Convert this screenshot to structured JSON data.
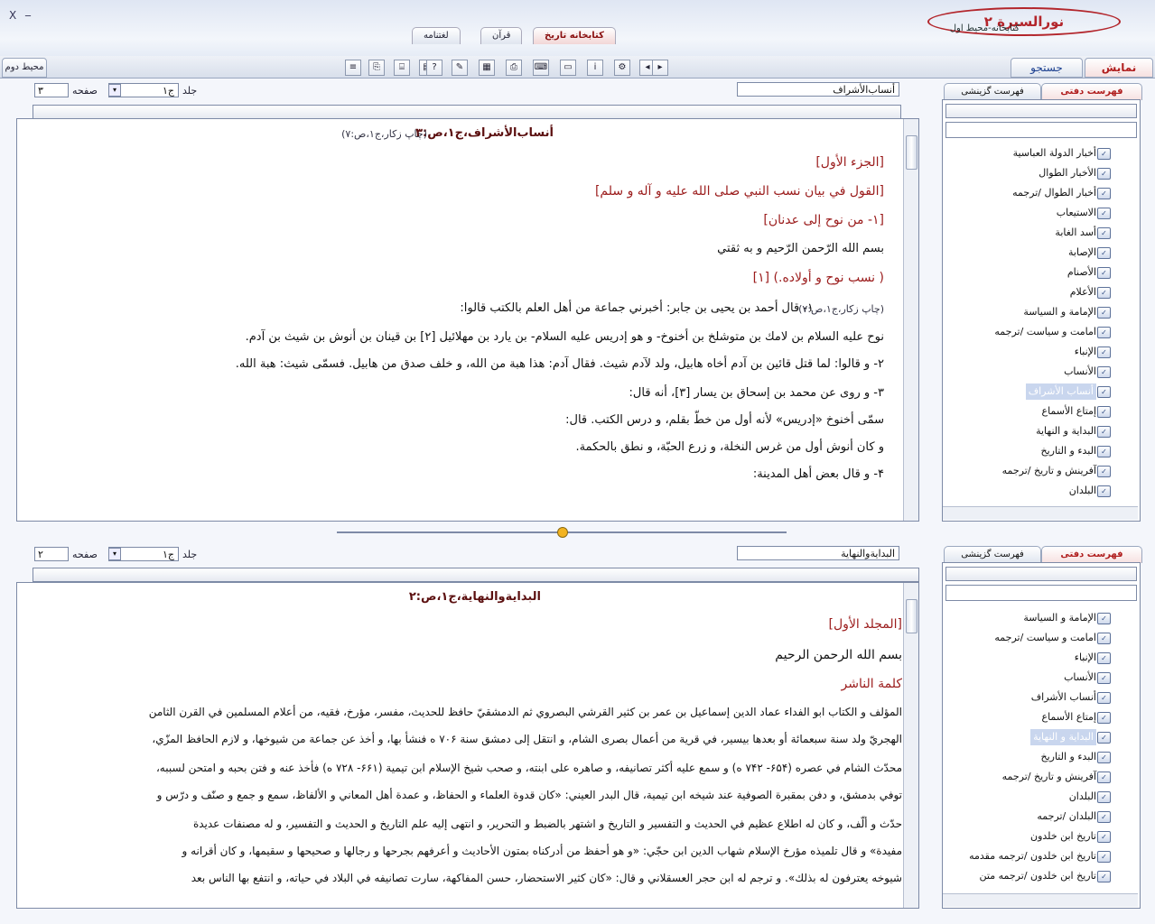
{
  "app": {
    "brand": "نورالسيرة ٢",
    "library_path": "كتابخانه-محيط اول",
    "minimize": "_",
    "close": "X"
  },
  "main_tabs": [
    "کتابخانه تاريخ",
    "قرآن",
    "لغتنامه"
  ],
  "second_bar": {
    "display": "نمايش",
    "search": "جستجو",
    "env2": "محيط دوم"
  },
  "pane1": {
    "book_select": "أنساب‌الأشراف",
    "jild_label": "جلد",
    "jild_value": "ج۱",
    "page_label": "صفحه",
    "page_value": "۳",
    "content_title": "أنساب‌الأشراف،ج۱،ص:۳",
    "content_title_note": "(چاپ زكار،ج۱،ص:۷)",
    "lines": [
      "[الجزء الأول]",
      "[القول في بيان نسب النبي صلى الله عليه و آله و سلم]",
      "[۱- من نوح إلى عدنان]",
      "بسم الله الرّحمن الرّحيم و به ثقتي",
      "( نسب نوح و أولاده.) [۱]",
      "۱- قال أحمد بن يحيى بن جابر: أخبرني جماعة من أهل العلم بالكتب قالوا:",
      "نوح عليه السلام بن لامك بن متوشلخ بن أخنوخ- و هو إدريس عليه السلام- بن يارد بن مهلائيل [۲] بن قينان بن أنوش بن شيث بن آدم.",
      "۲- و قالوا: لما قتل قائين بن آدم أخاه هابيل، ولد لآدم شيث. فقال آدم: هذا هبة من الله، و خلف صدق من هابيل. فسمّى شيث: هبة الله.",
      "۳- و روى عن محمد بن إسحاق بن يسار [۳]، أنه قال:",
      "سمّى أخنوخ «إدريس» لأنه أول من خطّ بقلم، و درس الكتب. قال:",
      "و كان أنوش أول من غرس النخلة، و زرع الحبّة، و نطق بالحكمة.",
      "۴- و قال بعض أهل المدينة:"
    ],
    "line2_prefix": "(چاپ زكار،ج۱،ص:۷)"
  },
  "pane2": {
    "book_select": "البداية‌والنهاية",
    "jild_label": "جلد",
    "jild_value": "ج۱",
    "page_label": "صفحه",
    "page_value": "۲",
    "content_title": "البداية‌والنهاية،ج۱،ص:۲",
    "lines": [
      "[المجلد الأول]",
      "بسم الله الرحمن الرحيم",
      "كلمة الناشر",
      "المؤلف و الكتاب ابو الفداء عماد الدين إسماعيل بن عمر بن كثير القرشي البصروي ثم الدمشقيّ حافظ للحديث، مفسر، مؤرخ، فقيه، من أعلام المسلمين في القرن الثامن",
      "الهجريّ ولد سنة سبعمائة أو بعدها بيسير، في قرية من أعمال بصرى الشام، و انتقل إلى دمشق سنة ۷۰۶ ه فنشأ بها، و أخذ عن جماعة من شيوخها، و لازم الحافظ المزّي،",
      "محدّث الشام في عصره (۶۵۴- ۷۴۲ ه) و سمع عليه أكثر تصانيفه، و صاهره على ابنته، و صحب شيخ الإسلام ابن تيمية (۶۶۱- ۷۲۸ ه) فأخذ عنه و فتن بحبه و امتحن لسببه،",
      "توفي بدمشق، و دفن بمقبرة الصوفية عند شيخه ابن تيمية، قال البدر العيني: «كان قدوة العلماء و الحفاظ، و عمدة أهل المعاني و الألفاظ، سمع و جمع و صنّف و درّس و",
      "حدّث و ألّف، و كان له اطلاع عظيم في الحديث و التفسير و التاريخ و اشتهر بالضبط و التحرير، و انتهى إليه علم التاريخ و الحديث و التفسير، و له مصنفات عديدة",
      "مفيدة» و قال تلميذه مؤرخ الإسلام شهاب الدين ابن حجّي: «و هو أحفظ من أدركناه بمتون الأحاديث و أعرفهم بجرحها و رجالها و صحيحها و سقيمها، و كان أقرانه و",
      "شيوخه يعترفون له بذلك». و ترجم له ابن حجر العسقلاني و قال: «كان كثير الاستحضار، حسن المفاكهة، سارت تصانيفه في البلاد في حياته، و انتفع بها الناس بعد"
    ]
  },
  "tree1": {
    "tab_index": "فهرست دفتى",
    "tab_search": "فهرست گزينشى",
    "items": [
      "أخبار الدولة العباسية",
      "الأخبار الطوال",
      "أخبار الطوال /ترجمه",
      "الاستيعاب",
      "أسد الغابة",
      "الإصابة",
      "الأصنام",
      "الأعلام",
      "الإمامة و السياسة",
      "امامت و سياست /ترجمه",
      "الإنباء",
      "الأنساب",
      "أنساب الأشراف",
      "إمتاع الأسماع",
      "البداية و النهاية",
      "البدء و التاريخ",
      "آفرينش و تاريخ /ترجمه",
      "البلدان"
    ],
    "selected": 12
  },
  "tree2": {
    "tab_index": "فهرست دفتى",
    "tab_search": "فهرست گزينشى",
    "items": [
      "الإمامة و السياسة",
      "امامت و سياست /ترجمه",
      "الإنباء",
      "الأنساب",
      "أنساب الأشراف",
      "إمتاع الأسماع",
      "البداية و النهاية",
      "البدء و التاريخ",
      "آفرينش و تاريخ /ترجمه",
      "البلدان",
      "البلدان /ترجمه",
      "تاريخ ابن خلدون",
      "تاريخ ابن خلدون /ترجمه مقدمه",
      "تاريخ ابن خلدون /ترجمه متن"
    ],
    "selected": 6
  },
  "icons": {
    "toolbar": [
      "list-icon",
      "copy-icon",
      "tree-icon",
      "book-icon",
      "help-icon",
      "note-icon",
      "grid-icon",
      "print-icon",
      "keyboard-icon",
      "page-icon",
      "info-icon",
      "settings-icon",
      "prev-icon",
      "next-icon"
    ]
  },
  "colors": {
    "accent_red": "#b3262c",
    "selection": "#c9d6ee",
    "border": "#7d8aa6"
  }
}
